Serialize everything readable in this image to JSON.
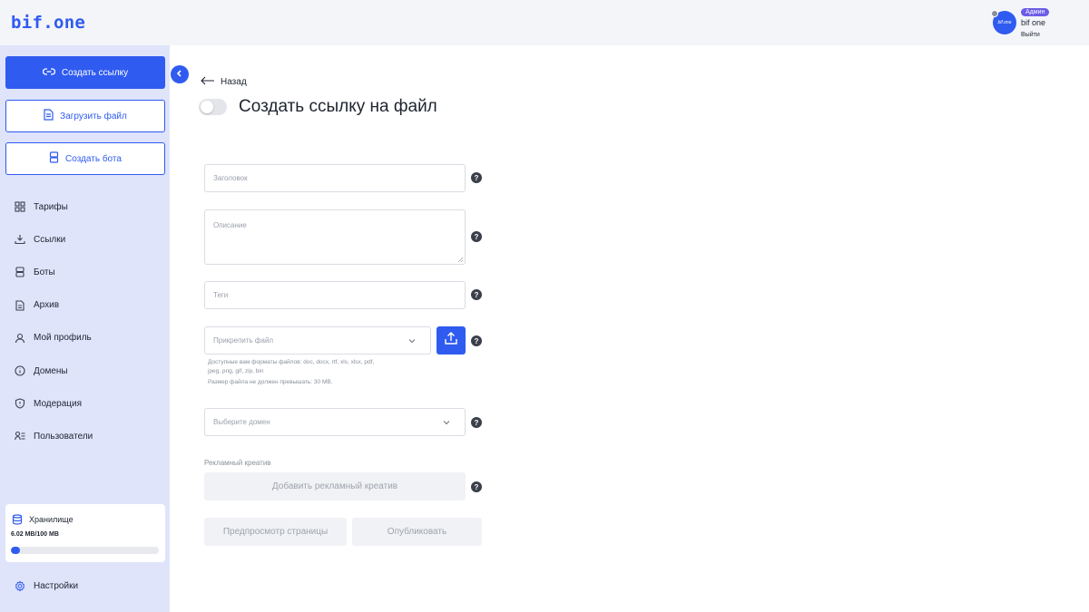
{
  "header": {
    "logo": "bif.one",
    "user": {
      "avatar_text": "bif.one",
      "role": "Админ",
      "name": "bif one",
      "logout": "Выйти"
    }
  },
  "sidebar": {
    "create_link": "Создать ссылку",
    "upload_file": "Загрузить файл",
    "create_bot": "Создать бота",
    "items": [
      {
        "label": "Тарифы",
        "icon": "grid-icon"
      },
      {
        "label": "Ссылки",
        "icon": "link-download-icon"
      },
      {
        "label": "Боты",
        "icon": "bot-icon"
      },
      {
        "label": "Архив",
        "icon": "document-icon"
      },
      {
        "label": "Мой профиль",
        "icon": "user-icon"
      },
      {
        "label": "Домены",
        "icon": "info-icon"
      },
      {
        "label": "Модерация",
        "icon": "shield-icon"
      },
      {
        "label": "Пользователи",
        "icon": "users-list-icon"
      }
    ],
    "storage": {
      "title": "Хранилище",
      "value": "6.02 MB/100 MB",
      "used_fraction": 0.06
    },
    "settings": "Настройки"
  },
  "main": {
    "back": "Назад",
    "title": "Создать ссылку на файл",
    "fields": {
      "title_placeholder": "Заголовок",
      "description_placeholder": "Описание",
      "tags_placeholder": "Теги",
      "attach_placeholder": "Прикрепить файл",
      "domain_placeholder": "Выберите домен"
    },
    "hint_line1": "Доступные вам форматы файлов: doc, docx, rtf, xls, xlsx, pdf,",
    "hint_line2": "jpeg, png, gif, zip, bin",
    "hint_line3": "Размер файла не должен превышать: 30 MB.",
    "creative_label": "Рекламный креатив",
    "add_creative": "Добавить рекламный креатив",
    "preview": "Предпросмотр страницы",
    "publish": "Опубликовать",
    "help_symbol": "?"
  },
  "colors": {
    "accent": "#2f5bf0",
    "sidebar_bg": "#dfe4fb",
    "role_badge": "#6b5ce7"
  }
}
